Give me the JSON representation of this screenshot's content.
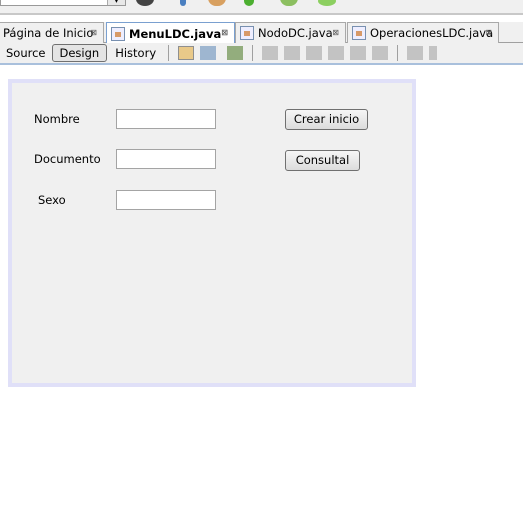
{
  "tabs": [
    {
      "label": "Página de Inicio",
      "active": false
    },
    {
      "label": "MenuLDC.java",
      "active": true
    },
    {
      "label": "NodoDC.java",
      "active": false
    },
    {
      "label": "OperacionesLDC.java",
      "active": false
    }
  ],
  "editor_toolbar": {
    "source": "Source",
    "design": "Design",
    "history": "History"
  },
  "form": {
    "labels": {
      "nombre": "Nombre",
      "documento": "Documento",
      "sexo": "Sexo"
    },
    "fields": {
      "nombre": "",
      "documento": "",
      "sexo": ""
    },
    "buttons": {
      "crear": "Crear inicio",
      "consultal": "Consultal"
    }
  },
  "colors": {
    "form_border": "#e0e0f8",
    "form_bg": "#f0f0f0",
    "active_tab_border": "#7aa0d0"
  }
}
